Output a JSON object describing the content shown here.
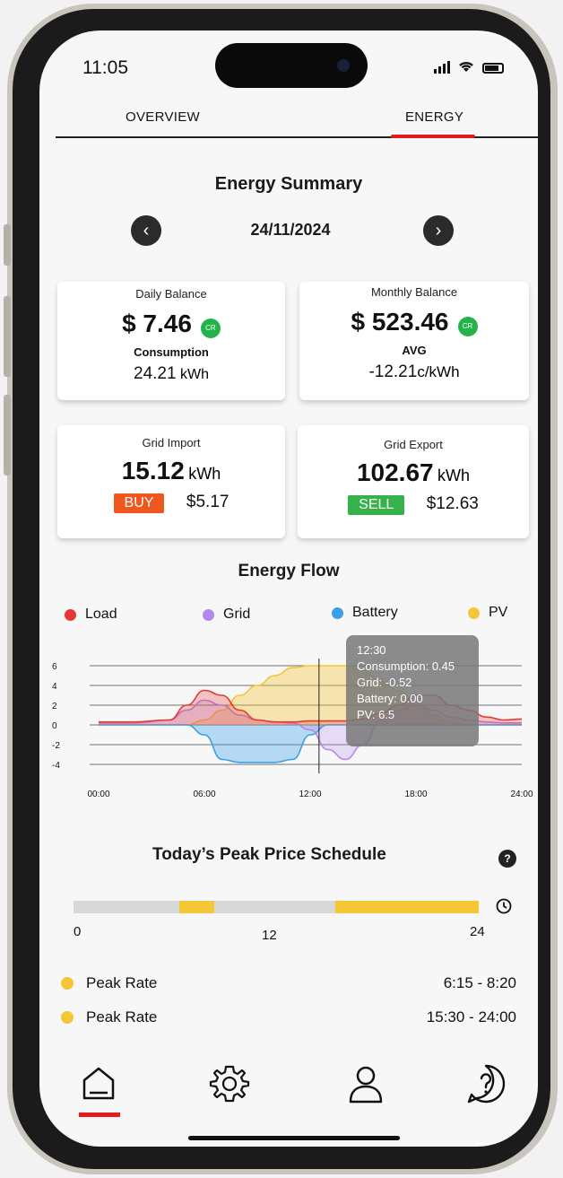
{
  "status_bar": {
    "time": "11:05"
  },
  "tabs": [
    {
      "label": "OVERVIEW"
    },
    {
      "label": "ENERGY"
    }
  ],
  "summary": {
    "title": "Energy Summary",
    "date": "24/11/2024"
  },
  "daily": {
    "label": "Daily Balance",
    "amount": "$ 7.46",
    "badge": "CR",
    "sub_label": "Consumption",
    "sub_value": "24.21",
    "sub_unit": "kWh"
  },
  "monthly": {
    "label": "Monthly Balance",
    "amount": "$ 523.46",
    "badge": "CR",
    "sub_label": "AVG",
    "sub_value": "-12.21",
    "sub_unit": "c/kWh"
  },
  "grid_import": {
    "label": "Grid Import",
    "value": "15.12",
    "unit": "kWh",
    "tag": "BUY",
    "price": "$5.17"
  },
  "grid_export": {
    "label": "Grid Export",
    "value": "102.67",
    "unit": "kWh",
    "tag": "SELL",
    "price": "$12.63"
  },
  "flow": {
    "title": "Energy Flow",
    "legend": [
      {
        "name": "Load",
        "color": "#e53935"
      },
      {
        "name": "Grid",
        "color": "#b388eb"
      },
      {
        "name": "Battery",
        "color": "#3aa0e8"
      },
      {
        "name": "PV",
        "color": "#f5c636"
      }
    ],
    "yticks": [
      "6",
      "4",
      "2",
      "0",
      "-2",
      "-4"
    ],
    "xticks": [
      "00:00",
      "06:00",
      "12:00",
      "18:00",
      "24:00"
    ],
    "tooltip": {
      "time": "12:30",
      "consumption": "Consumption: 0.45",
      "grid": "Grid: -0.52",
      "battery": "Battery:  0.00",
      "pv": "PV: 6.5"
    }
  },
  "chart_data": {
    "type": "area",
    "x_hours": [
      0,
      2,
      4,
      5,
      6,
      7,
      8,
      9,
      10,
      11,
      12,
      13,
      14,
      15,
      16,
      17,
      18,
      19,
      20,
      21,
      22,
      23,
      24
    ],
    "ylim": [
      -4,
      6
    ],
    "series": [
      {
        "name": "Load",
        "values": [
          0.3,
          0.3,
          0.5,
          2.0,
          3.5,
          3.0,
          1.5,
          0.5,
          0.3,
          0.3,
          0.4,
          0.4,
          0.4,
          0.6,
          1.2,
          2.0,
          3.0,
          3.0,
          2.0,
          1.5,
          0.8,
          0.5,
          0.6
        ]
      },
      {
        "name": "Grid",
        "values": [
          0.2,
          0.2,
          0.5,
          1.5,
          2.5,
          2.0,
          1.0,
          0.5,
          0.3,
          0.2,
          -0.5,
          -2.5,
          -3.5,
          -2.0,
          0.5,
          1.5,
          2.0,
          1.5,
          0.8,
          0.5,
          0.3,
          0.2,
          0.2
        ]
      },
      {
        "name": "Battery",
        "values": [
          0,
          0,
          0,
          0,
          -1.0,
          -3.5,
          -3.8,
          -3.8,
          -3.8,
          -3.5,
          -1.0,
          0,
          0,
          0,
          0,
          0,
          0,
          0,
          0,
          0,
          0,
          0,
          0
        ]
      },
      {
        "name": "PV",
        "values": [
          0,
          0,
          0,
          0,
          0.5,
          1.5,
          3.0,
          4.0,
          5.0,
          5.8,
          6.0,
          6.0,
          6.0,
          5.5,
          4.5,
          3.5,
          2.0,
          1.0,
          0.2,
          0,
          0,
          0,
          0
        ]
      }
    ]
  },
  "schedule": {
    "title": "Today’s Peak Price Schedule",
    "help": "?",
    "axis": [
      "0",
      "12",
      "24"
    ],
    "segments": [
      [
        6.25,
        8.33
      ],
      [
        15.5,
        24
      ]
    ],
    "items": [
      {
        "label": "Peak Rate",
        "range": "6:15 - 8:20"
      },
      {
        "label": "Peak Rate",
        "range": "15:30 - 24:00"
      }
    ]
  }
}
